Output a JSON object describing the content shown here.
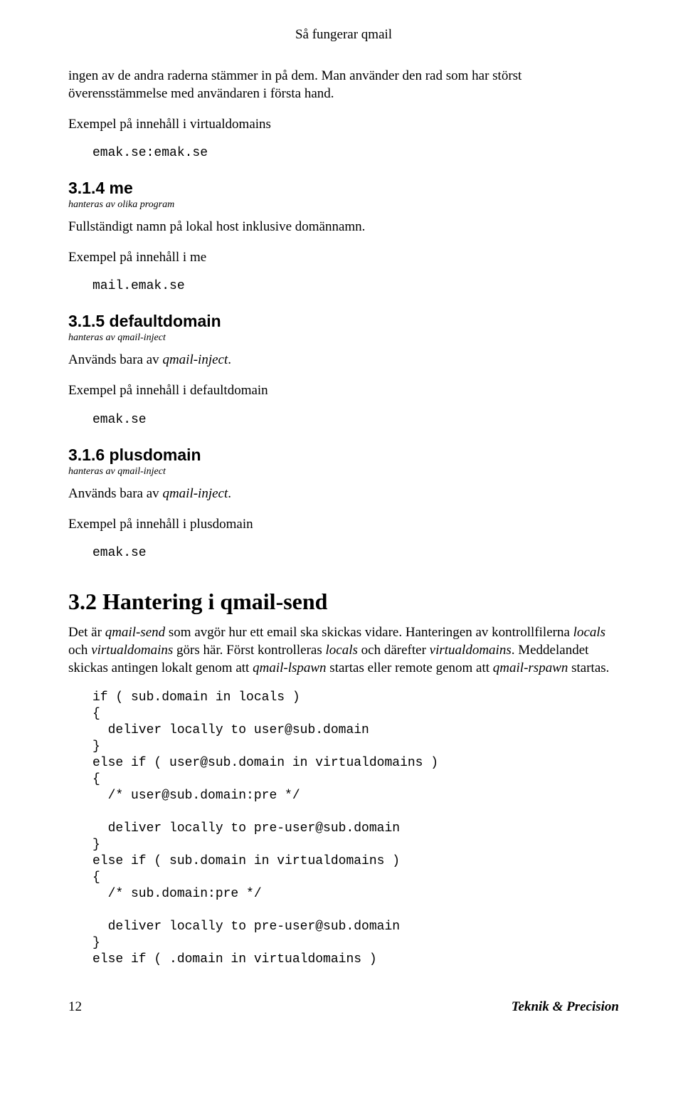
{
  "header": {
    "running": "Så fungerar qmail"
  },
  "intro": {
    "p1": "ingen av de andra raderna stämmer in på dem. Man använder den rad som har störst överensstämmelse med användaren i första hand.",
    "p2": "Exempel på innehåll i virtualdomains",
    "code": "emak.se:emak.se"
  },
  "s314": {
    "title": "3.1.4 me",
    "sub": "hanteras av olika program",
    "p1": "Fullständigt namn på lokal host inklusive domännamn.",
    "p2": "Exempel på innehåll i me",
    "code": "mail.emak.se"
  },
  "s315": {
    "title": "3.1.5 defaultdomain",
    "sub": "hanteras av qmail-inject",
    "p1a": "Används bara av ",
    "p1b": "qmail-inject",
    "p1c": ".",
    "p2": "Exempel på innehåll i defaultdomain",
    "code": "emak.se"
  },
  "s316": {
    "title": "3.1.6 plusdomain",
    "sub": "hanteras av qmail-inject",
    "p1a": "Används bara av ",
    "p1b": "qmail-inject",
    "p1c": ".",
    "p2": "Exempel på innehåll i plusdomain",
    "code": "emak.se"
  },
  "s32": {
    "title": "3.2 Hantering i qmail-send",
    "p1_parts": [
      {
        "t": "Det är "
      },
      {
        "t": "qmail-send",
        "i": true
      },
      {
        "t": " som avgör hur ett email ska skickas vidare. Hanteringen av kontrollfilerna "
      },
      {
        "t": "locals",
        "i": true
      },
      {
        "t": " och "
      },
      {
        "t": "virtualdomains",
        "i": true
      },
      {
        "t": " görs här. Först kontrolleras "
      },
      {
        "t": "locals",
        "i": true
      },
      {
        "t": " och därefter "
      },
      {
        "t": "virtualdomains",
        "i": true
      },
      {
        "t": ". Meddelandet skickas antingen lokalt genom att "
      },
      {
        "t": "qmail-lspawn",
        "i": true
      },
      {
        "t": " startas eller remote genom att "
      },
      {
        "t": "qmail-rspawn",
        "i": true
      },
      {
        "t": " startas."
      }
    ],
    "code": "if ( sub.domain in locals )\n{\n  deliver locally to user@sub.domain\n}\nelse if ( user@sub.domain in virtualdomains )\n{\n  /* user@sub.domain:pre */\n\n  deliver locally to pre-user@sub.domain\n}\nelse if ( sub.domain in virtualdomains )\n{\n  /* sub.domain:pre */\n\n  deliver locally to pre-user@sub.domain\n}\nelse if ( .domain in virtualdomains )"
  },
  "footer": {
    "page": "12",
    "brand": "Teknik & Precision"
  }
}
